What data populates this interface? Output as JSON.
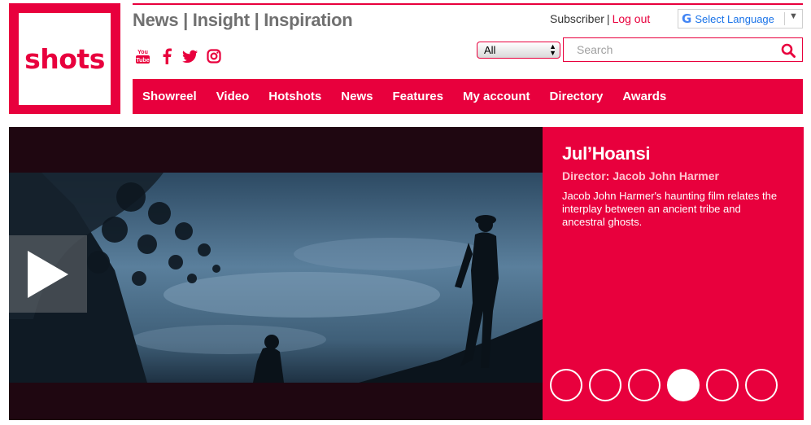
{
  "logo": {
    "text": "shots"
  },
  "header": {
    "tagline": "News | Insight | Inspiration",
    "social_icons": [
      "youtube-icon",
      "facebook-icon",
      "twitter-icon",
      "instagram-icon"
    ],
    "account": {
      "status": "Subscriber",
      "separator": "|",
      "logout": "Log out"
    },
    "translate": {
      "label": "Select Language"
    },
    "filter": {
      "selected": "All"
    },
    "search": {
      "placeholder": "Search"
    }
  },
  "nav": {
    "items": [
      "Showreel",
      "Video",
      "Hotshots",
      "News",
      "Features",
      "My account",
      "Directory",
      "Awards"
    ]
  },
  "hero": {
    "title": "Jul’Hoansi",
    "director": "Director: Jacob John Harmer",
    "description": "Jacob John Harmer's haunting film relates the interplay between an ancient tribe and ancestral ghosts.",
    "slide_count": 6,
    "active_slide": 4
  },
  "colors": {
    "brand": "#e8003d",
    "tagline": "#707070",
    "director": "#ffc2cf"
  }
}
